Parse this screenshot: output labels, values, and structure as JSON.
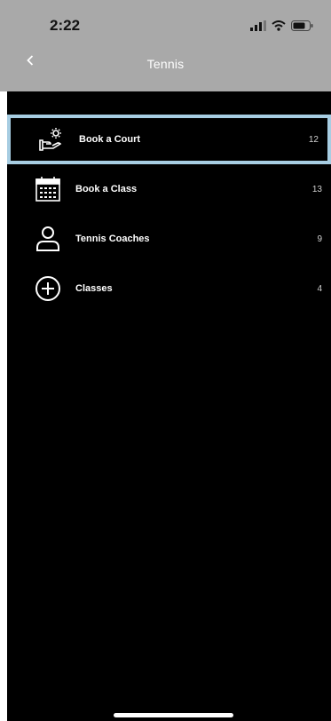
{
  "status_bar": {
    "time": "2:22",
    "icons": [
      "signal-icon",
      "wifi-icon",
      "battery-icon"
    ]
  },
  "nav": {
    "back_icon": "chevron-left-icon",
    "title": "Tennis"
  },
  "list": {
    "items": [
      {
        "label": "Book a Court",
        "count": "12",
        "icon": "hand-gear-icon",
        "selected": true
      },
      {
        "label": "Book a Class",
        "count": "13",
        "icon": "calendar-icon",
        "selected": false
      },
      {
        "label": "Tennis Coaches",
        "count": "9",
        "icon": "person-icon",
        "selected": false
      },
      {
        "label": "Classes",
        "count": "4",
        "icon": "plus-circle-icon",
        "selected": false
      }
    ]
  },
  "colors": {
    "top_bar": "#a9a9a9",
    "panel": "#000000",
    "selection_border": "#a7cde2",
    "text": "#ffffff"
  }
}
